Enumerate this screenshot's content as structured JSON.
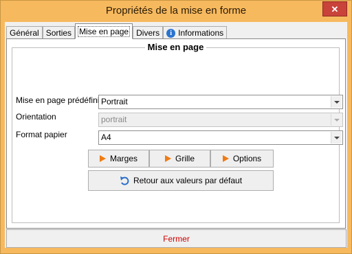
{
  "window": {
    "title": "Propriétés de la mise en forme",
    "close_symbol": "✕"
  },
  "tabs": [
    {
      "label": "Général"
    },
    {
      "label": "Sorties"
    },
    {
      "label": "Mise en page"
    },
    {
      "label": "Divers"
    },
    {
      "label": "Informations",
      "icon": "info-icon"
    }
  ],
  "group": {
    "title": "Mise en page"
  },
  "fields": {
    "preset": {
      "label": "Mise en page prédéfinie",
      "value": "Portrait"
    },
    "orientation": {
      "label": "Orientation",
      "value": "portrait",
      "disabled": true
    },
    "paper": {
      "label": "Format papier",
      "value": "A4"
    }
  },
  "buttons": {
    "margins": "Marges",
    "grid": "Grille",
    "options": "Options",
    "reset": "Retour aux valeurs par défaut",
    "close": "Fermer"
  },
  "colors": {
    "title_bar": "#f7b95e",
    "close_button": "#c9433a",
    "accent_icon": "#f07b14",
    "close_label": "#cc0000"
  }
}
